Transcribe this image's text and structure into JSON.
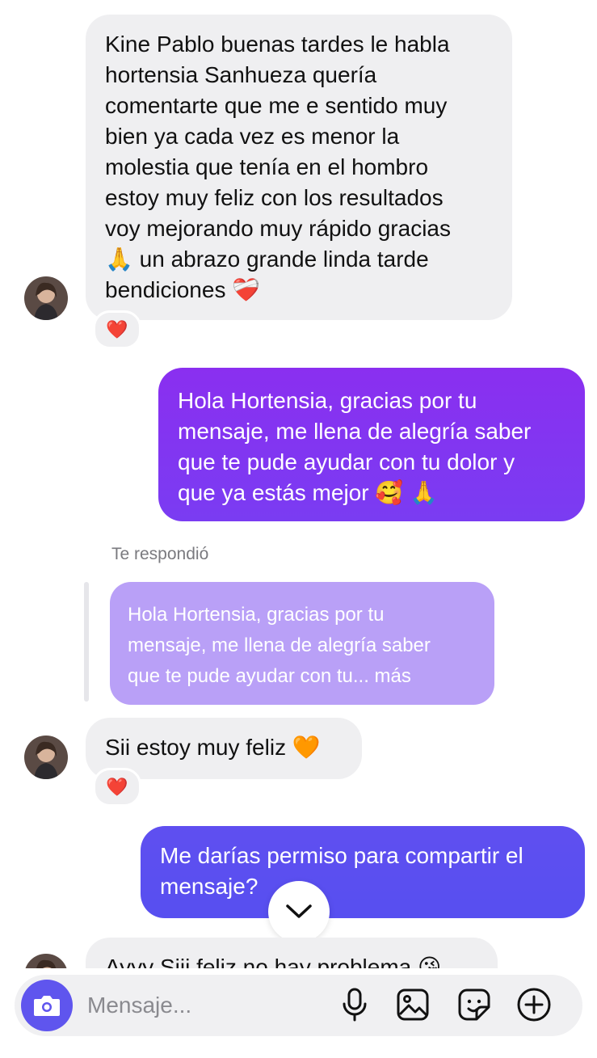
{
  "messages": [
    {
      "direction": "incoming",
      "text": "Kine Pablo buenas tardes le habla\nhortensia Sanhueza quería\ncomentarte que me e sentido muy\nbien ya cada vez es menor la\nmolestia que tenía en el hombro\nestoy muy feliz con los resultados\nvoy mejorando muy rápido gracias\n🙏 un abrazo grande linda tarde\nbendiciones ❤️‍🩹",
      "reaction": "❤️"
    },
    {
      "direction": "outgoing",
      "text": "Hola Hortensia, gracias por tu\nmensaje, me llena de alegría saber\nque te pude ayudar con tu dolor y\nque ya estás mejor 🥰 🙏"
    },
    {
      "direction": "incoming",
      "reply_label": "Te respondió",
      "quoted_text": "Hola Hortensia, gracias por tu\nmensaje, me llena de alegría saber\nque te pude ayudar con tu... más",
      "text": "Sii estoy muy feliz 🧡",
      "reaction": "❤️"
    },
    {
      "direction": "outgoing",
      "text": "Me darías permiso para compartir el\nmensaje?"
    },
    {
      "direction": "incoming",
      "text": "Ayyy Siii feliz no hay problema 😘"
    }
  ],
  "composer": {
    "placeholder": "Mensaje...",
    "camera_icon": "camera-icon",
    "mic_icon": "microphone-icon",
    "gallery_icon": "image-gallery-icon",
    "sticker_icon": "sticker-icon",
    "plus_icon": "plus-circle-icon"
  },
  "colors": {
    "incoming_bubble": "#efeff1",
    "outgoing_gradient_top": "#8a2ff0",
    "outgoing_gradient_bottom": "#5b4ff0",
    "quoted_bubble": "#b9a0f7",
    "camera_button": "#5f55ee"
  }
}
